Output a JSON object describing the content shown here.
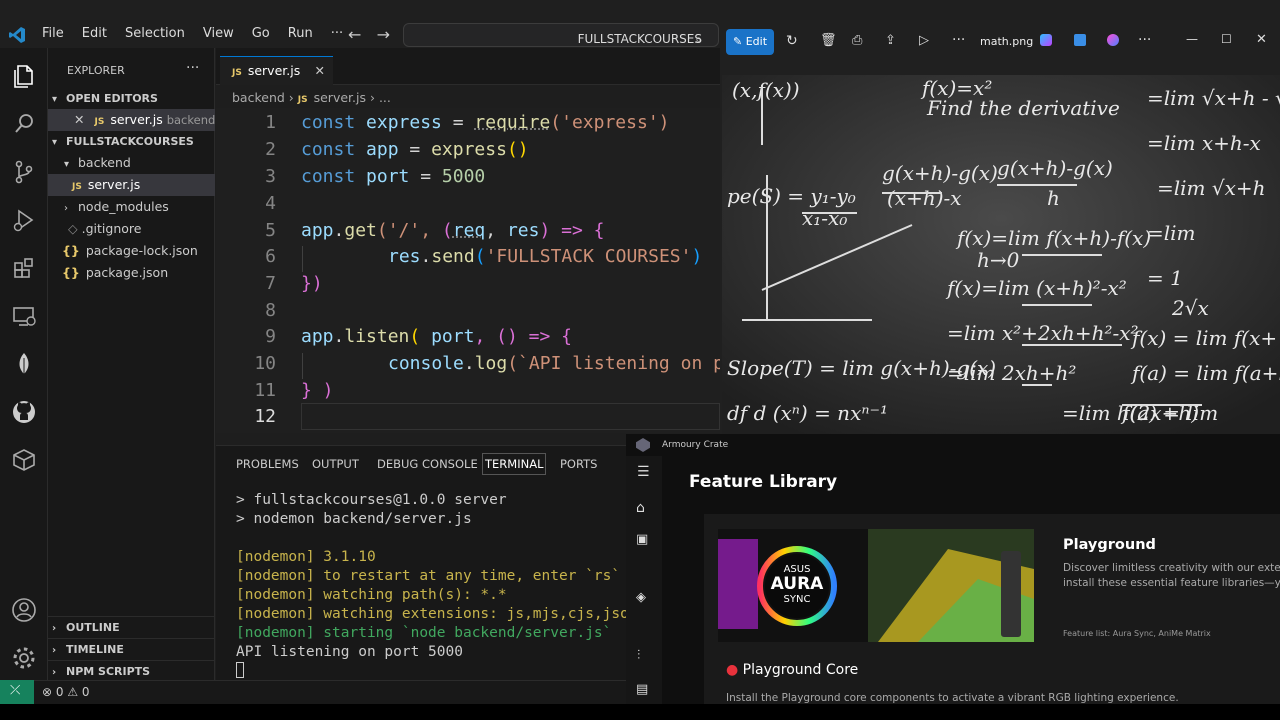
{
  "vscode": {
    "menu": [
      "File",
      "Edit",
      "Selection",
      "View",
      "Go",
      "Run",
      "···"
    ],
    "search": "FULLSTACKCOURSES",
    "explorer_title": "EXPLORER",
    "open_editors": "OPEN EDITORS",
    "open_editor_file": "server.js",
    "open_editor_dir": "backend",
    "project": "FULLSTACKCOURSES",
    "tree": [
      "backend",
      "server.js",
      "node_modules",
      ".gitignore",
      "package-lock.json",
      "package.json"
    ],
    "outline": "OUTLINE",
    "timeline": "TIMELINE",
    "npm": "NPM SCRIPTS",
    "tab": "server.js",
    "breadcrumb": [
      "backend",
      "server.js",
      "..."
    ],
    "line_numbers": [
      "1",
      "2",
      "3",
      "4",
      "5",
      "6",
      "7",
      "8",
      "9",
      "10",
      "11",
      "12"
    ],
    "code": [
      [
        "const",
        "express",
        "=",
        "require",
        "('express')"
      ],
      [
        "const",
        "app",
        "=",
        "express",
        "()"
      ],
      [
        "const",
        "port",
        "=",
        "5000"
      ],
      [],
      [
        "app",
        ".",
        "get",
        "('/', ",
        "(",
        "req",
        ", ",
        "res",
        ") => {"
      ],
      [
        "res",
        ".",
        "send",
        "(",
        "'FULLSTACK COURSES'",
        ")"
      ],
      [
        "})"
      ],
      [],
      [
        "app",
        ".",
        "listen",
        "( ",
        "port",
        ", () => {"
      ],
      [
        "console",
        ".",
        "log",
        "(`API listening on p"
      ],
      [
        "} )"
      ],
      []
    ],
    "panel_tabs": [
      "PROBLEMS",
      "OUTPUT",
      "DEBUG CONSOLE",
      "TERMINAL",
      "PORTS"
    ],
    "terminal": [
      "> fullstackcourses@1.0.0 server",
      "> nodemon backend/server.js",
      "",
      "[nodemon] 3.1.10",
      "[nodemon] to restart at any time, enter `rs`",
      "[nodemon] watching path(s): *.*",
      "[nodemon] watching extensions: js,mjs,cjs,json",
      "[nodemon] starting `node backend/server.js`",
      "API listening on port 5000"
    ],
    "status": "⊗ 0 ⚠ 0"
  },
  "photos": {
    "edit": "Edit",
    "filename": "math.png"
  },
  "armoury": {
    "title": "Armoury Crate",
    "heading": "Feature Library",
    "card_title": "Playground",
    "card_desc1": "Discover limitless creativity with our exter",
    "card_desc2": "install these essential feature libraries—y",
    "feature_list": "Feature list: Aura Sync, AniMe Matrix",
    "core": "Playground Core",
    "core_desc": "Install the Playground core components to activate a vibrant RGB lighting experience.",
    "aura1": "ASUS",
    "aura2": "AURA",
    "aura3": "SYNC"
  }
}
